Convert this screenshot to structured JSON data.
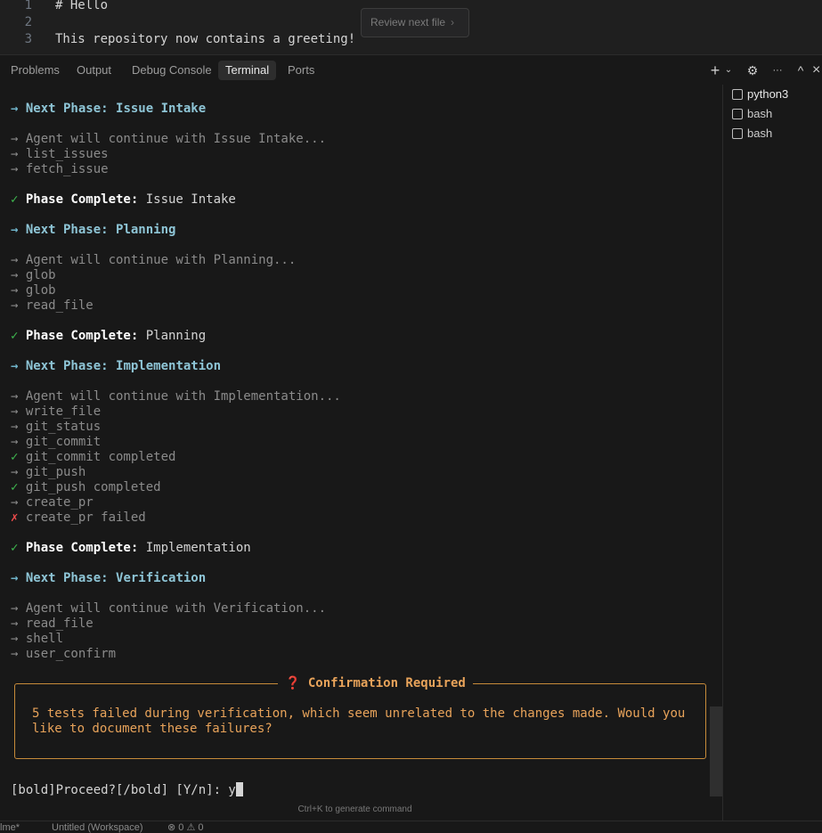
{
  "editor": {
    "lines": [
      {
        "num": "1",
        "text": "# Hello"
      },
      {
        "num": "2",
        "text": ""
      },
      {
        "num": "3",
        "text": "This repository now contains a greeting!"
      }
    ],
    "review_button": "Review next file",
    "review_chevron": "›"
  },
  "panel": {
    "tabs": [
      "Problems",
      "Output",
      "Debug Console",
      "Terminal",
      "Ports"
    ],
    "active_tab": "Terminal",
    "actions": {
      "add": "+",
      "add_dropdown": "⌄",
      "settings": "⚙",
      "more": "···",
      "maximize": "^",
      "close": "×"
    }
  },
  "terminal": {
    "lines": [
      {
        "prefix": "→ ",
        "label": "Next Phase: ",
        "value": "Issue Intake",
        "kind": "next"
      },
      {
        "prefix": "→ ",
        "text": "Agent will continue with Issue Intake...",
        "kind": "gray"
      },
      {
        "prefix": "→ ",
        "text": "list_issues",
        "kind": "gray"
      },
      {
        "prefix": "→ ",
        "text": "fetch_issue",
        "kind": "gray"
      },
      {
        "prefix": "✓ ",
        "label": "Phase Complete: ",
        "value": "Issue Intake",
        "kind": "complete"
      },
      {
        "prefix": "→ ",
        "label": "Next Phase: ",
        "value": "Planning",
        "kind": "next"
      },
      {
        "prefix": "→ ",
        "text": "Agent will continue with Planning...",
        "kind": "gray"
      },
      {
        "prefix": "→ ",
        "text": "glob",
        "kind": "gray"
      },
      {
        "prefix": "→ ",
        "text": "glob",
        "kind": "gray"
      },
      {
        "prefix": "→ ",
        "text": "read_file",
        "kind": "gray"
      },
      {
        "prefix": "✓ ",
        "label": "Phase Complete: ",
        "value": "Planning",
        "kind": "complete"
      },
      {
        "prefix": "→ ",
        "label": "Next Phase: ",
        "value": "Implementation",
        "kind": "next"
      },
      {
        "prefix": "→ ",
        "text": "Agent will continue with Implementation...",
        "kind": "gray"
      },
      {
        "prefix": "→ ",
        "text": "write_file",
        "kind": "gray"
      },
      {
        "prefix": "→ ",
        "text": "git_status",
        "kind": "gray"
      },
      {
        "prefix": "→ ",
        "text": "git_commit",
        "kind": "gray"
      },
      {
        "prefix": "✓ ",
        "text": "git_commit completed",
        "kind": "ok"
      },
      {
        "prefix": "→ ",
        "text": "git_push",
        "kind": "gray"
      },
      {
        "prefix": "✓ ",
        "text": "git_push completed",
        "kind": "ok"
      },
      {
        "prefix": "→ ",
        "text": "create_pr",
        "kind": "gray"
      },
      {
        "prefix": "✗ ",
        "text": "create_pr failed",
        "kind": "fail"
      },
      {
        "prefix": "✓ ",
        "label": "Phase Complete: ",
        "value": "Implementation",
        "kind": "complete"
      },
      {
        "prefix": "→ ",
        "label": "Next Phase: ",
        "value": "Verification",
        "kind": "next"
      },
      {
        "prefix": "→ ",
        "text": "Agent will continue with Verification...",
        "kind": "gray"
      },
      {
        "prefix": "→ ",
        "text": "read_file",
        "kind": "gray"
      },
      {
        "prefix": "→ ",
        "text": "shell",
        "kind": "gray"
      },
      {
        "prefix": "→ ",
        "text": "user_confirm",
        "kind": "gray"
      }
    ],
    "confirm": {
      "title": "❓ Confirmation Required",
      "body": "5 tests failed during verification, which seem unrelated to the changes made. Would you like to document these failures?"
    },
    "prompt": "[bold]Proceed?[/bold] [Y/n]: y",
    "hint": "Ctrl+K to generate command"
  },
  "terminal_list": [
    "python3",
    "bash",
    "bash"
  ],
  "statusbar": {
    "left": "lme*",
    "workspace": "Untitled (Workspace)",
    "problems": "⊗ 0 ⚠ 0"
  }
}
